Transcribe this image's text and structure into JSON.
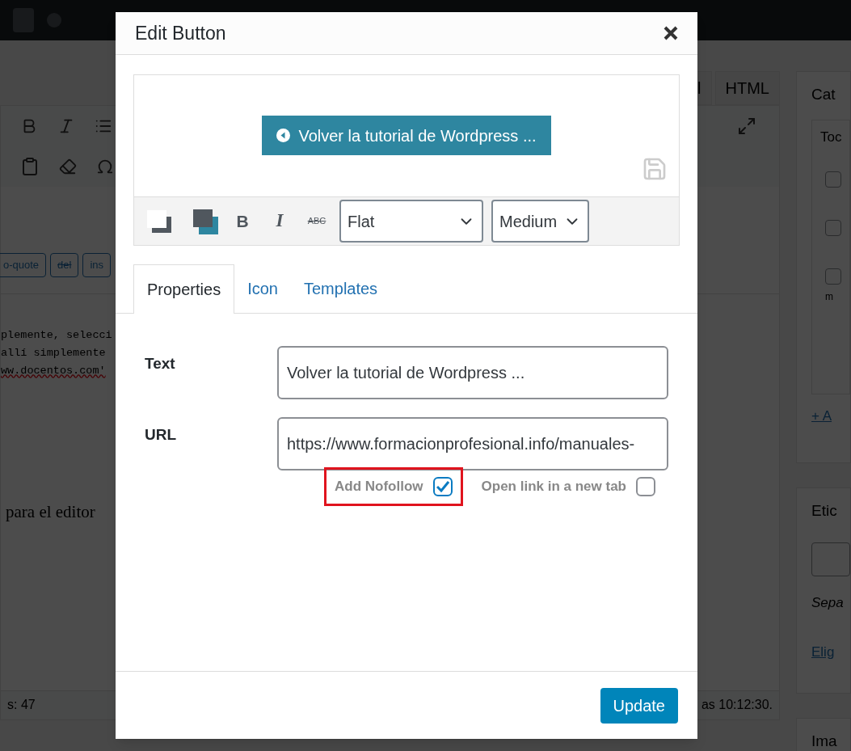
{
  "background": {
    "editor": {
      "tabs": [
        "l",
        "HTML"
      ],
      "quicktags": [
        "o-quote",
        "del",
        "ins"
      ],
      "code_lines": [
        "plemente, selecci",
        "allí simplemente",
        "ww.docentos.com'"
      ],
      "visual_text": "para el editor",
      "word_count": "s: 47",
      "last_saved": "as 10:12:30."
    },
    "sidebar": {
      "categories": {
        "title": "Cat",
        "tab": "Toc",
        "item": "m",
        "add_link": "+ A",
        "checkboxes": [
          {
            "checked": false
          },
          {
            "checked": false
          },
          {
            "checked": false
          }
        ]
      },
      "tags": {
        "title": "Etic",
        "hint": "Sepa",
        "link": "Elig"
      },
      "image": {
        "title": "Ima"
      }
    }
  },
  "dialog": {
    "title": "Edit Button",
    "preview": {
      "button_label": "Volver la tutorial de Wordpress ..."
    },
    "toolbar": {
      "style": "Flat",
      "size": "Medium",
      "bold": "B",
      "italic": "I",
      "strike": "ABC"
    },
    "tabs": [
      {
        "label": "Properties",
        "selected": true
      },
      {
        "label": "Icon",
        "selected": false
      },
      {
        "label": "Templates",
        "selected": false
      }
    ],
    "fields": [
      {
        "label": "Text",
        "value": "Volver la tutorial de Wordpress ..."
      },
      {
        "label": "URL",
        "value": "https://www.formacionprofesional.info/manuales-"
      }
    ],
    "options": [
      {
        "label": "Add Nofollow",
        "checked": true,
        "highlighted": true
      },
      {
        "label": "Open link in a new tab",
        "checked": false,
        "highlighted": false
      }
    ],
    "buttons": [
      "Update"
    ]
  }
}
